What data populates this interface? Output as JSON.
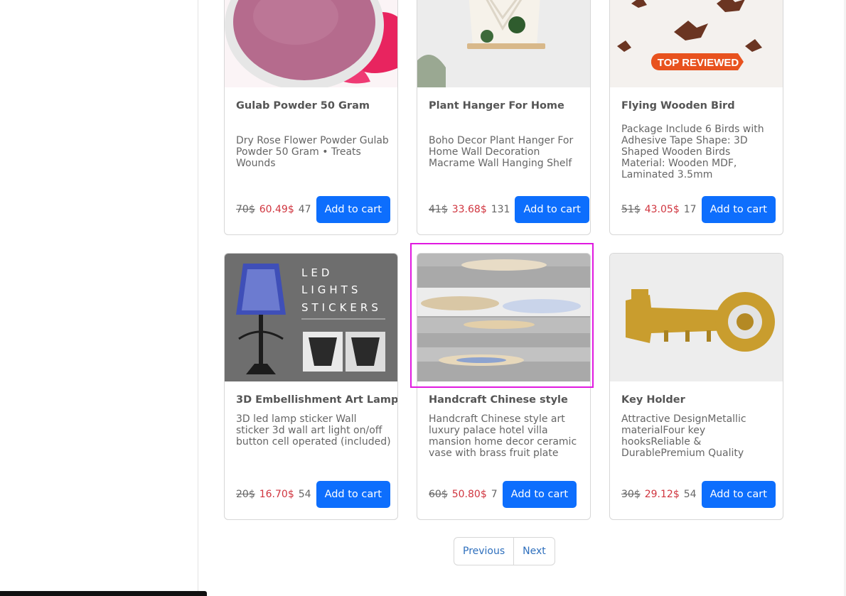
{
  "products": [
    {
      "title": "Gulab Powder 50 Gram",
      "description": "Dry Rose Flower Powder Gulab Powder 50 Gram • Treats Wounds",
      "old_price": "70$",
      "new_price": "60.49$",
      "stock": "47",
      "button": "Add to cart"
    },
    {
      "title": "Plant Hanger For Home",
      "description": "Boho Decor Plant Hanger For Home Wall Decoration Macrame Wall Hanging Shelf",
      "old_price": "41$",
      "new_price": "33.68$",
      "stock": "131",
      "button": "Add to cart"
    },
    {
      "title": "Flying Wooden Bird",
      "description": "Package Include 6 Birds with Adhesive Tape Shape: 3D Shaped Wooden Birds Material: Wooden MDF, Laminated 3.5mm",
      "old_price": "51$",
      "new_price": "43.05$",
      "stock": "17",
      "button": "Add to cart",
      "image_badge": "TOP REVIEWED"
    },
    {
      "title": "3D Embellishment Art Lamp",
      "description": "3D led lamp sticker Wall sticker 3d wall art light on/off button cell operated (included)",
      "old_price": "20$",
      "new_price": "16.70$",
      "stock": "54",
      "button": "Add to cart",
      "image_text": [
        "LED",
        "LIGHTS",
        "STICKERS"
      ]
    },
    {
      "title": "Handcraft Chinese style",
      "description": "Handcraft Chinese style art luxury palace hotel villa mansion home decor ceramic vase with brass fruit plate",
      "old_price": "60$",
      "new_price": "50.80$",
      "stock": "7",
      "button": "Add to cart"
    },
    {
      "title": "Key Holder",
      "description": "Attractive DesignMetallic materialFour key hooksReliable & DurablePremium Quality",
      "old_price": "30$",
      "new_price": "29.12$",
      "stock": "54",
      "button": "Add to cart"
    }
  ],
  "pagination": {
    "previous": "Previous",
    "next": "Next"
  },
  "colors": {
    "primary": "#0d6efd",
    "sale_price": "#d0353f",
    "highlight": "#e019e0",
    "link": "#2e6fbd"
  }
}
